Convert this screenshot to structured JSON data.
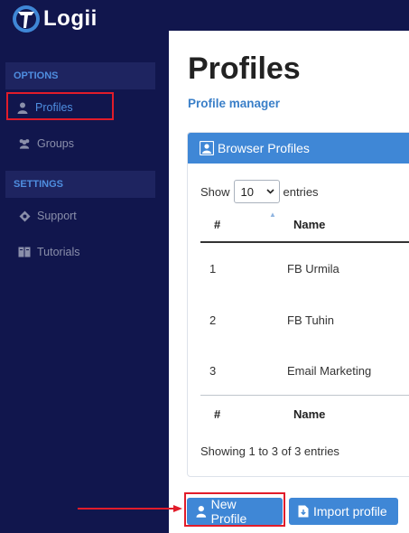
{
  "brand": {
    "name": "Logii"
  },
  "sidebar": {
    "sections": [
      {
        "label": "OPTIONS"
      },
      {
        "label": "SETTINGS"
      }
    ],
    "items": [
      {
        "label": "Profiles",
        "icon": "user-icon"
      },
      {
        "label": "Groups",
        "icon": "users-icon"
      },
      {
        "label": "Support",
        "icon": "support-icon"
      },
      {
        "label": "Tutorials",
        "icon": "book-icon"
      }
    ]
  },
  "page": {
    "title": "Profiles",
    "subtitle": "Profile manager"
  },
  "card": {
    "header": "Browser Profiles",
    "show_label": "Show",
    "page_size": "10",
    "entries_label": "entries",
    "columns": [
      "#",
      "Name"
    ],
    "rows": [
      {
        "num": "1",
        "name": "FB Urmila"
      },
      {
        "num": "2",
        "name": "FB Tuhin"
      },
      {
        "num": "3",
        "name": "Email Marketing"
      }
    ],
    "info": "Showing 1 to 3 of 3 entries"
  },
  "actions": {
    "new_profile": "New Profile",
    "import_profile": "Import profile"
  },
  "colors": {
    "sidebar_bg": "#11164d",
    "accent": "#3f87d6",
    "highlight": "#e11c2a"
  }
}
